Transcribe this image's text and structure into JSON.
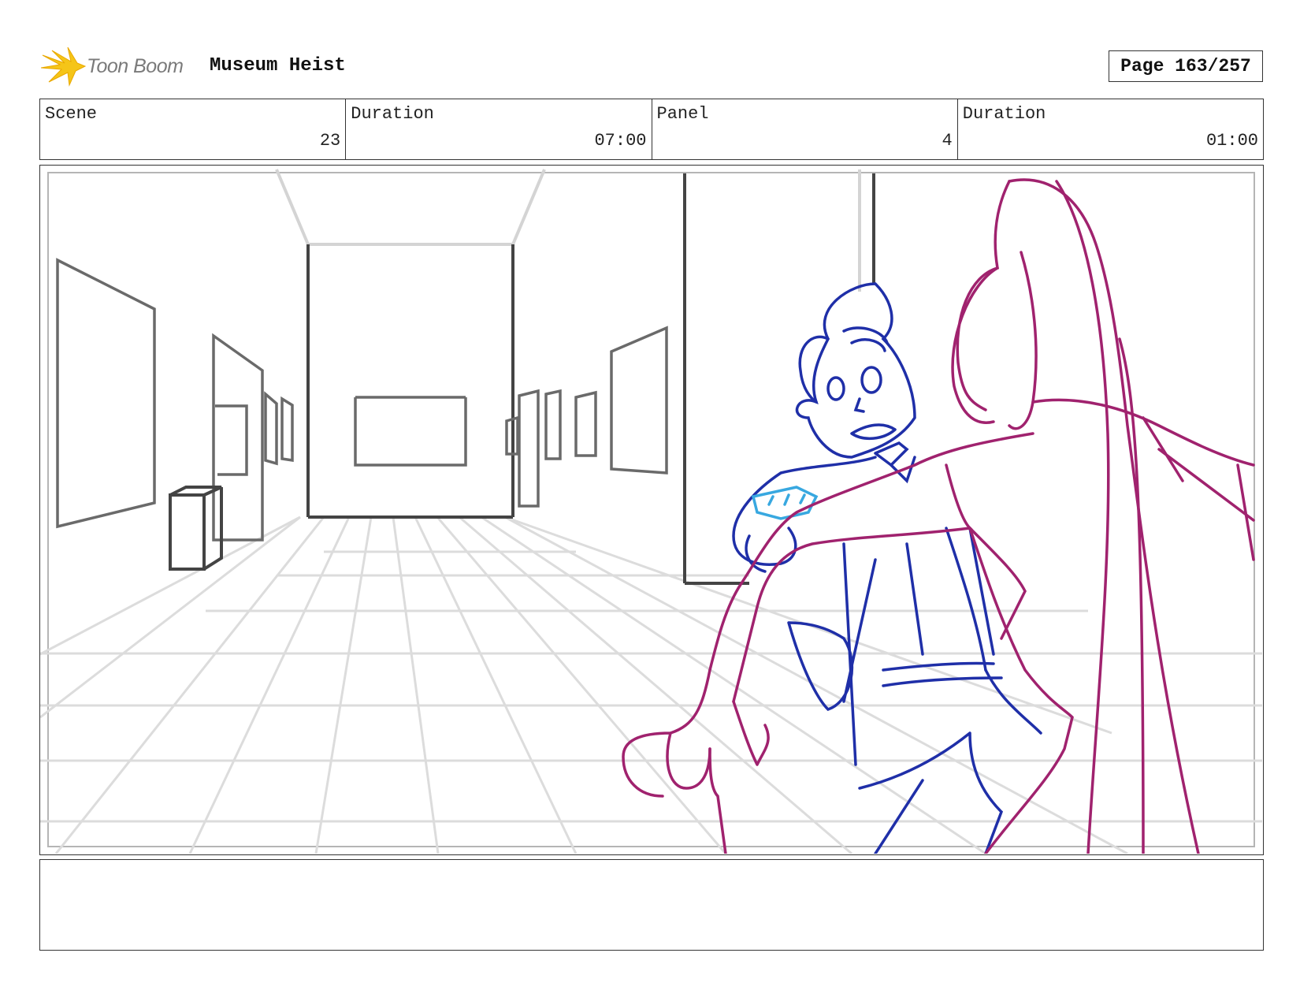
{
  "header": {
    "logo_text": "Toon Boom",
    "project_title": "Museum Heist",
    "page_label": "Page 163/257"
  },
  "info": {
    "scene_label": "Scene",
    "scene_value": "23",
    "scene_duration_label": "Duration",
    "scene_duration_value": "07:00",
    "panel_label": "Panel",
    "panel_value": "4",
    "panel_duration_label": "Duration",
    "panel_duration_value": "01:00"
  },
  "notes": {
    "text": ""
  },
  "colors": {
    "logo_flame": "#f5c518",
    "character_man": "#1f2fa8",
    "character_woman": "#a0226e",
    "prop_highlight": "#38a8e0",
    "background_lines": "#d9d9d9",
    "room_lines": "#444444"
  }
}
